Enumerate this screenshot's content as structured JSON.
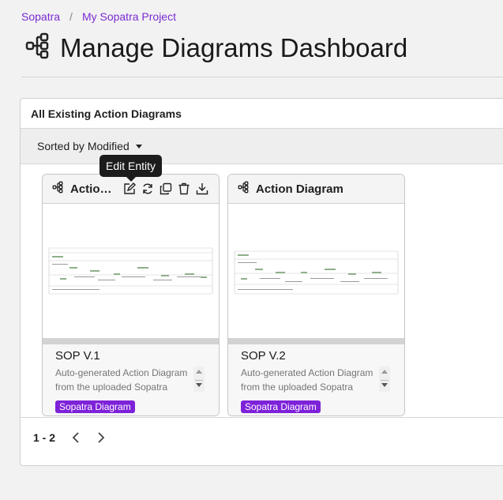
{
  "breadcrumb": {
    "items": [
      "Sopatra",
      "My Sopatra Project"
    ],
    "separator": "/"
  },
  "page": {
    "title": "Manage Diagrams Dashboard"
  },
  "panel": {
    "header": "All Existing Action Diagrams",
    "sort_label": "Sorted by Modified"
  },
  "tooltip": "Edit Entity",
  "cards": [
    {
      "name": "Actio…",
      "version": "SOP V.1",
      "description": "Auto-generated Action Diagram from the uploaded Sopatra",
      "badge": "Sopatra Diagram"
    },
    {
      "name": "Action Diagram",
      "version": "SOP V.2",
      "description": "Auto-generated Action Diagram from the uploaded Sopatra",
      "badge": "Sopatra Diagram"
    }
  ],
  "pager": {
    "range": "1 - 2"
  },
  "colors": {
    "accent": "#7e22d9",
    "link": "#7a2bd1"
  },
  "icons": [
    "diagram-icon",
    "edit-icon",
    "refresh-icon",
    "copy-icon",
    "trash-icon",
    "download-icon",
    "chevron-left-icon",
    "chevron-right-icon",
    "caret-down-icon"
  ]
}
